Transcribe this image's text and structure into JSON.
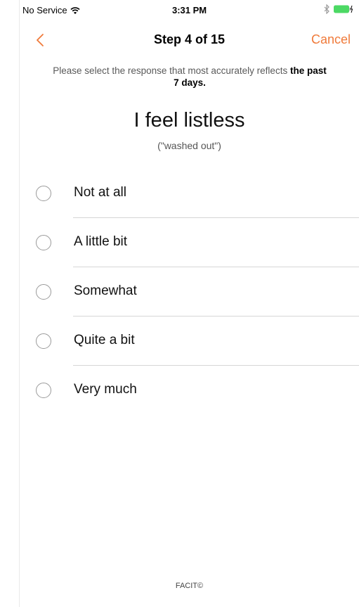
{
  "status_bar": {
    "carrier": "No Service",
    "time": "3:31 PM"
  },
  "nav": {
    "title": "Step 4 of 15",
    "cancel_label": "Cancel",
    "accent_color": "#f07a3a"
  },
  "instructions": {
    "text": "Please select the response that most accurately reflects ",
    "emphasis": "the past 7 days."
  },
  "question": {
    "title": "I feel listless",
    "subtitle": "(\"washed out\")"
  },
  "options": [
    {
      "label": "Not at all",
      "selected": false
    },
    {
      "label": "A little bit",
      "selected": false
    },
    {
      "label": "Somewhat",
      "selected": false
    },
    {
      "label": "Quite a bit",
      "selected": false
    },
    {
      "label": "Very much",
      "selected": false
    }
  ],
  "footer": {
    "text": "FACIT©"
  }
}
